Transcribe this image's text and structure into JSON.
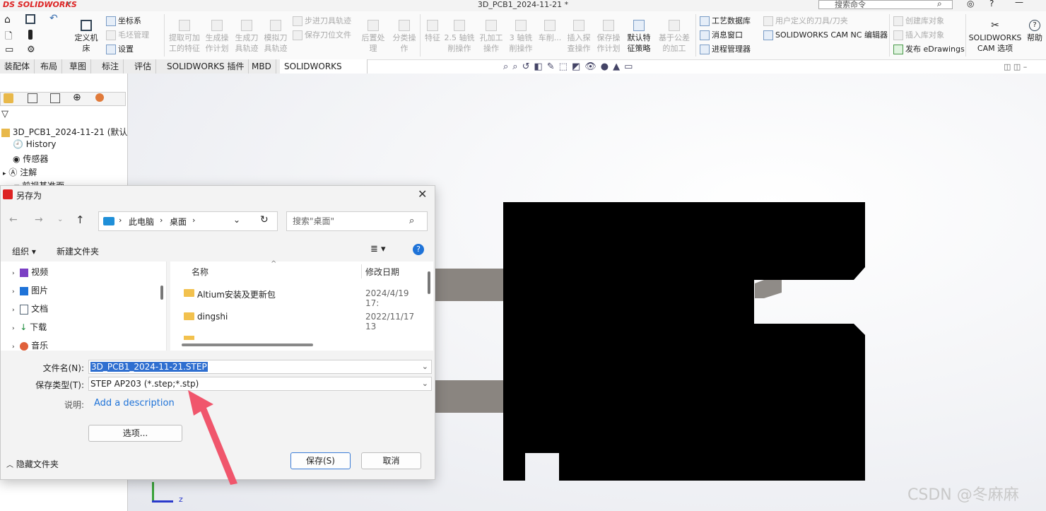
{
  "app": {
    "logo": "DS SOLIDWORKS",
    "title": "3D_PCB1_2024-11-21 *",
    "search_placeholder": "搜索命令"
  },
  "ribbon": {
    "groups": [
      {
        "label": "定义机床",
        "enabled": true
      },
      {
        "label": "坐标系",
        "enabled": true
      },
      {
        "label": "毛坯管理",
        "enabled": false
      },
      {
        "label": "设置",
        "enabled": true
      },
      {
        "label": "提取可加工的特征",
        "enabled": false
      },
      {
        "label": "生成操作计划",
        "enabled": false
      },
      {
        "label": "生成刀具轨迹",
        "enabled": false
      },
      {
        "label": "模拟刀具轨迹",
        "enabled": false
      },
      {
        "label": "步进刀具轨迹",
        "enabled": false
      },
      {
        "label": "保存刀位文件",
        "enabled": false
      },
      {
        "label": "后置处理",
        "enabled": false
      },
      {
        "label": "分类操作",
        "enabled": false
      },
      {
        "label": "特征",
        "enabled": false
      },
      {
        "label": "2.5 轴铣削操作",
        "enabled": false
      },
      {
        "label": "孔加工操作",
        "enabled": false
      },
      {
        "label": "3 轴铣削操作",
        "enabled": false
      },
      {
        "label": "车削...",
        "enabled": false
      },
      {
        "label": "插入探查操作",
        "enabled": false
      },
      {
        "label": "保存操作计划",
        "enabled": false
      },
      {
        "label": "默认特征策略",
        "enabled": true
      },
      {
        "label": "基于公差的加工",
        "enabled": false
      },
      {
        "label": "工艺数据库",
        "enabled": true
      },
      {
        "label": "消息窗口",
        "enabled": true
      },
      {
        "label": "进程管理器",
        "enabled": true
      },
      {
        "label": "用户定义的刀具/刀夹",
        "enabled": false
      },
      {
        "label": "SOLIDWORKS CAM NC 编辑器",
        "enabled": true
      },
      {
        "label": "创建库对象",
        "enabled": false
      },
      {
        "label": "插入库对象",
        "enabled": false
      },
      {
        "label": "发布 eDrawings",
        "enabled": true
      },
      {
        "label": "SOLIDWORKS CAM 选项",
        "enabled": true
      },
      {
        "label": "帮助",
        "enabled": true
      }
    ]
  },
  "tabs": [
    "装配体",
    "布局",
    "草图",
    "标注",
    "评估",
    "SOLIDWORKS 插件",
    "MBD",
    "SOLIDWORKS CAM"
  ],
  "active_tab": "SOLIDWORKS CAM",
  "tree": {
    "root": "3D_PCB1_2024-11-21  (默认",
    "items": [
      "History",
      "传感器",
      "注解",
      "前视基准面"
    ]
  },
  "dialog": {
    "title": "另存为",
    "breadcrumb": [
      "此电脑",
      "桌面"
    ],
    "search_placeholder": "搜索\"桌面\"",
    "organize": "组织 ▾",
    "new_folder": "新建文件夹",
    "nav_items": [
      "视频",
      "图片",
      "文档",
      "下载",
      "音乐"
    ],
    "columns": {
      "name": "名称",
      "modified": "修改日期"
    },
    "files": [
      {
        "name": "Altium安装及更新包",
        "modified": "2024/4/19 17:"
      },
      {
        "name": "dingshi",
        "modified": "2022/11/17 13"
      }
    ],
    "filename_label": "文件名(N):",
    "filename_value": "3D_PCB1_2024-11-21.STEP",
    "filetype_label": "保存类型(T):",
    "filetype_value": "STEP AP203 (*.step;*.stp)",
    "desc_label": "说明:",
    "desc_link": "Add a description",
    "options_button": "选项...",
    "hide_folders": "隐藏文件夹",
    "save_button": "保存(S)",
    "cancel_button": "取消"
  },
  "axis": {
    "z": "z"
  },
  "watermark": "CSDN @冬麻麻",
  "colors": {
    "accent": "#3b7cd6",
    "arrow": "#f0566c",
    "selection": "#2f6fd0"
  }
}
